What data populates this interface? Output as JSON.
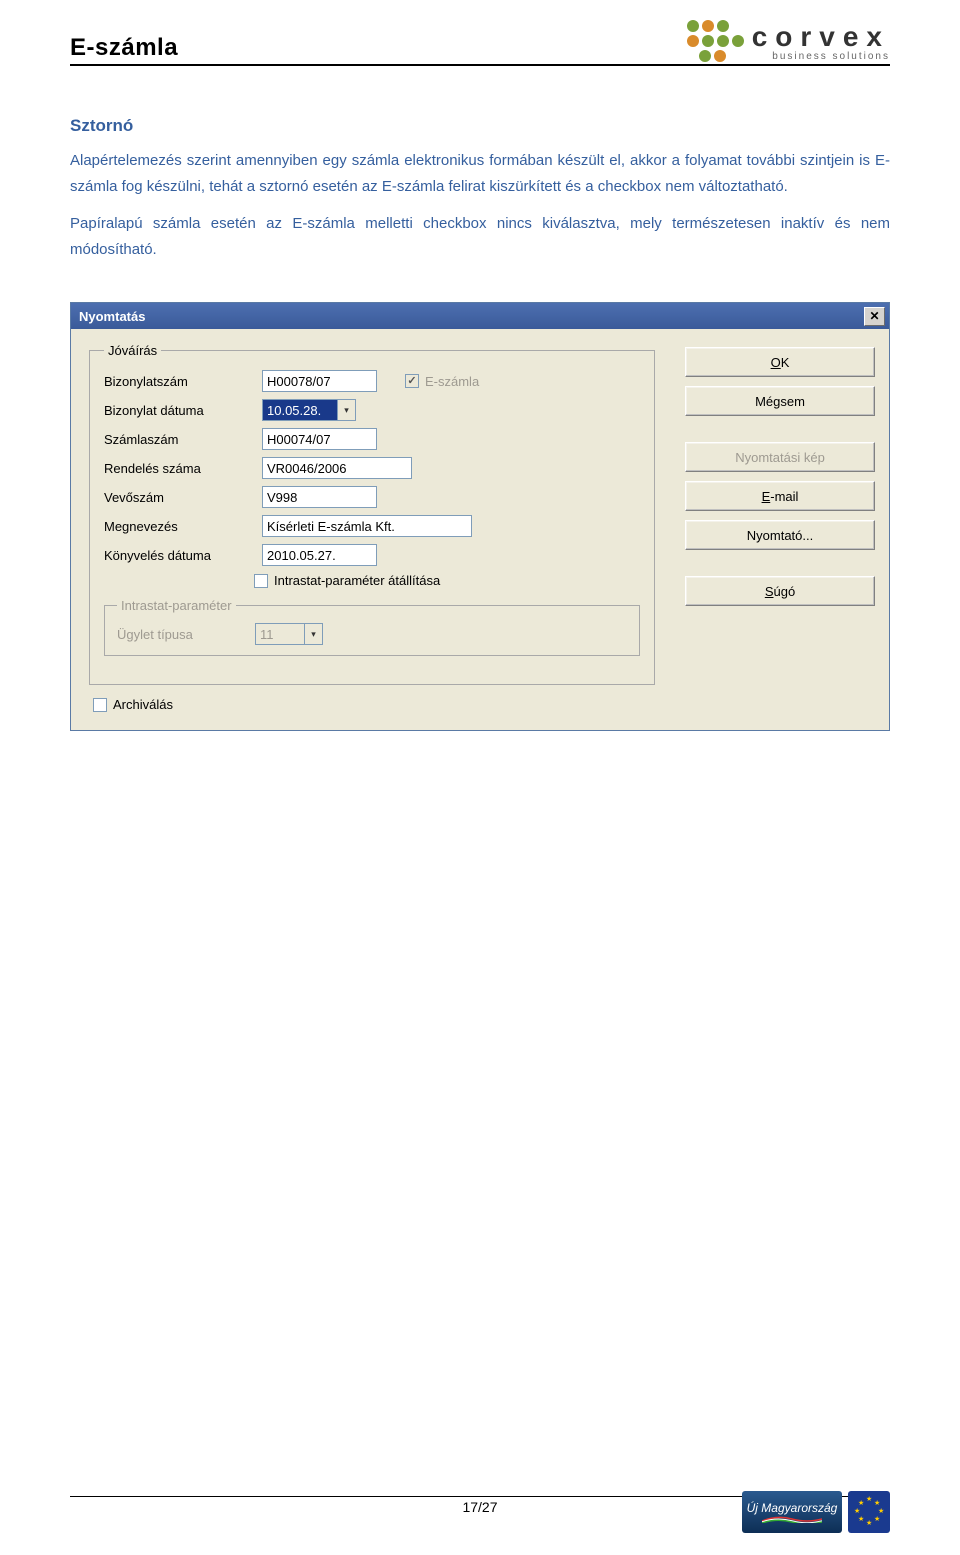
{
  "header": {
    "title": "E-számla",
    "logo_name": "corvex",
    "logo_sub": "business solutions"
  },
  "section": {
    "heading": "Sztornó",
    "paragraph": "Alapértelemezés szerint amennyiben egy számla elektronikus formában készült el, akkor a folyamat további szintjein is E-számla fog készülni, tehát a sztornó esetén az E-számla felirat kiszürkített és a checkbox nem változtatható.",
    "paragraph2": "Papíralapú számla esetén az E-számla melletti checkbox nincs kiválasztva, mely természetesen inaktív és nem módosítható."
  },
  "dialog": {
    "title": "Nyomtatás",
    "groupbox_jovairas": "Jóváírás",
    "fields": {
      "bizonylatszam_label": "Bizonylatszám",
      "bizonylatszam_value": "H00078/07",
      "eszamla_label": "E-számla",
      "bizonylat_datuma_label": "Bizonylat dátuma",
      "bizonylat_datuma_value": "10.05.28.",
      "szamlaszam_label": "Számlaszám",
      "szamlaszam_value": "H00074/07",
      "rendeles_szama_label": "Rendelés száma",
      "rendeles_szama_value": "VR0046/2006",
      "vevoszam_label": "Vevőszám",
      "vevoszam_value": "V998",
      "megnevezes_label": "Megnevezés",
      "megnevezes_value": "Kísérleti E-számla Kft.",
      "konyveles_datuma_label": "Könyvelés dátuma",
      "konyveles_datuma_value": "2010.05.27.",
      "intrastat_param_atallitasa": "Intrastat-paraméter átállítása",
      "groupbox_intrastat": "Intrastat-paraméter",
      "ugylet_tipusa_label": "Ügylet típusa",
      "ugylet_tipusa_value": "11",
      "archivalas_label": "Archiválás"
    },
    "buttons": {
      "ok": "OK",
      "megsem": "Mégsem",
      "nyomtatasi_kep": "Nyomtatási kép",
      "email": "E-mail",
      "nyomtato": "Nyomtató...",
      "sugo": "Súgó"
    }
  },
  "footer": {
    "page": "17/27",
    "badge_text": "Új Magyarország"
  }
}
